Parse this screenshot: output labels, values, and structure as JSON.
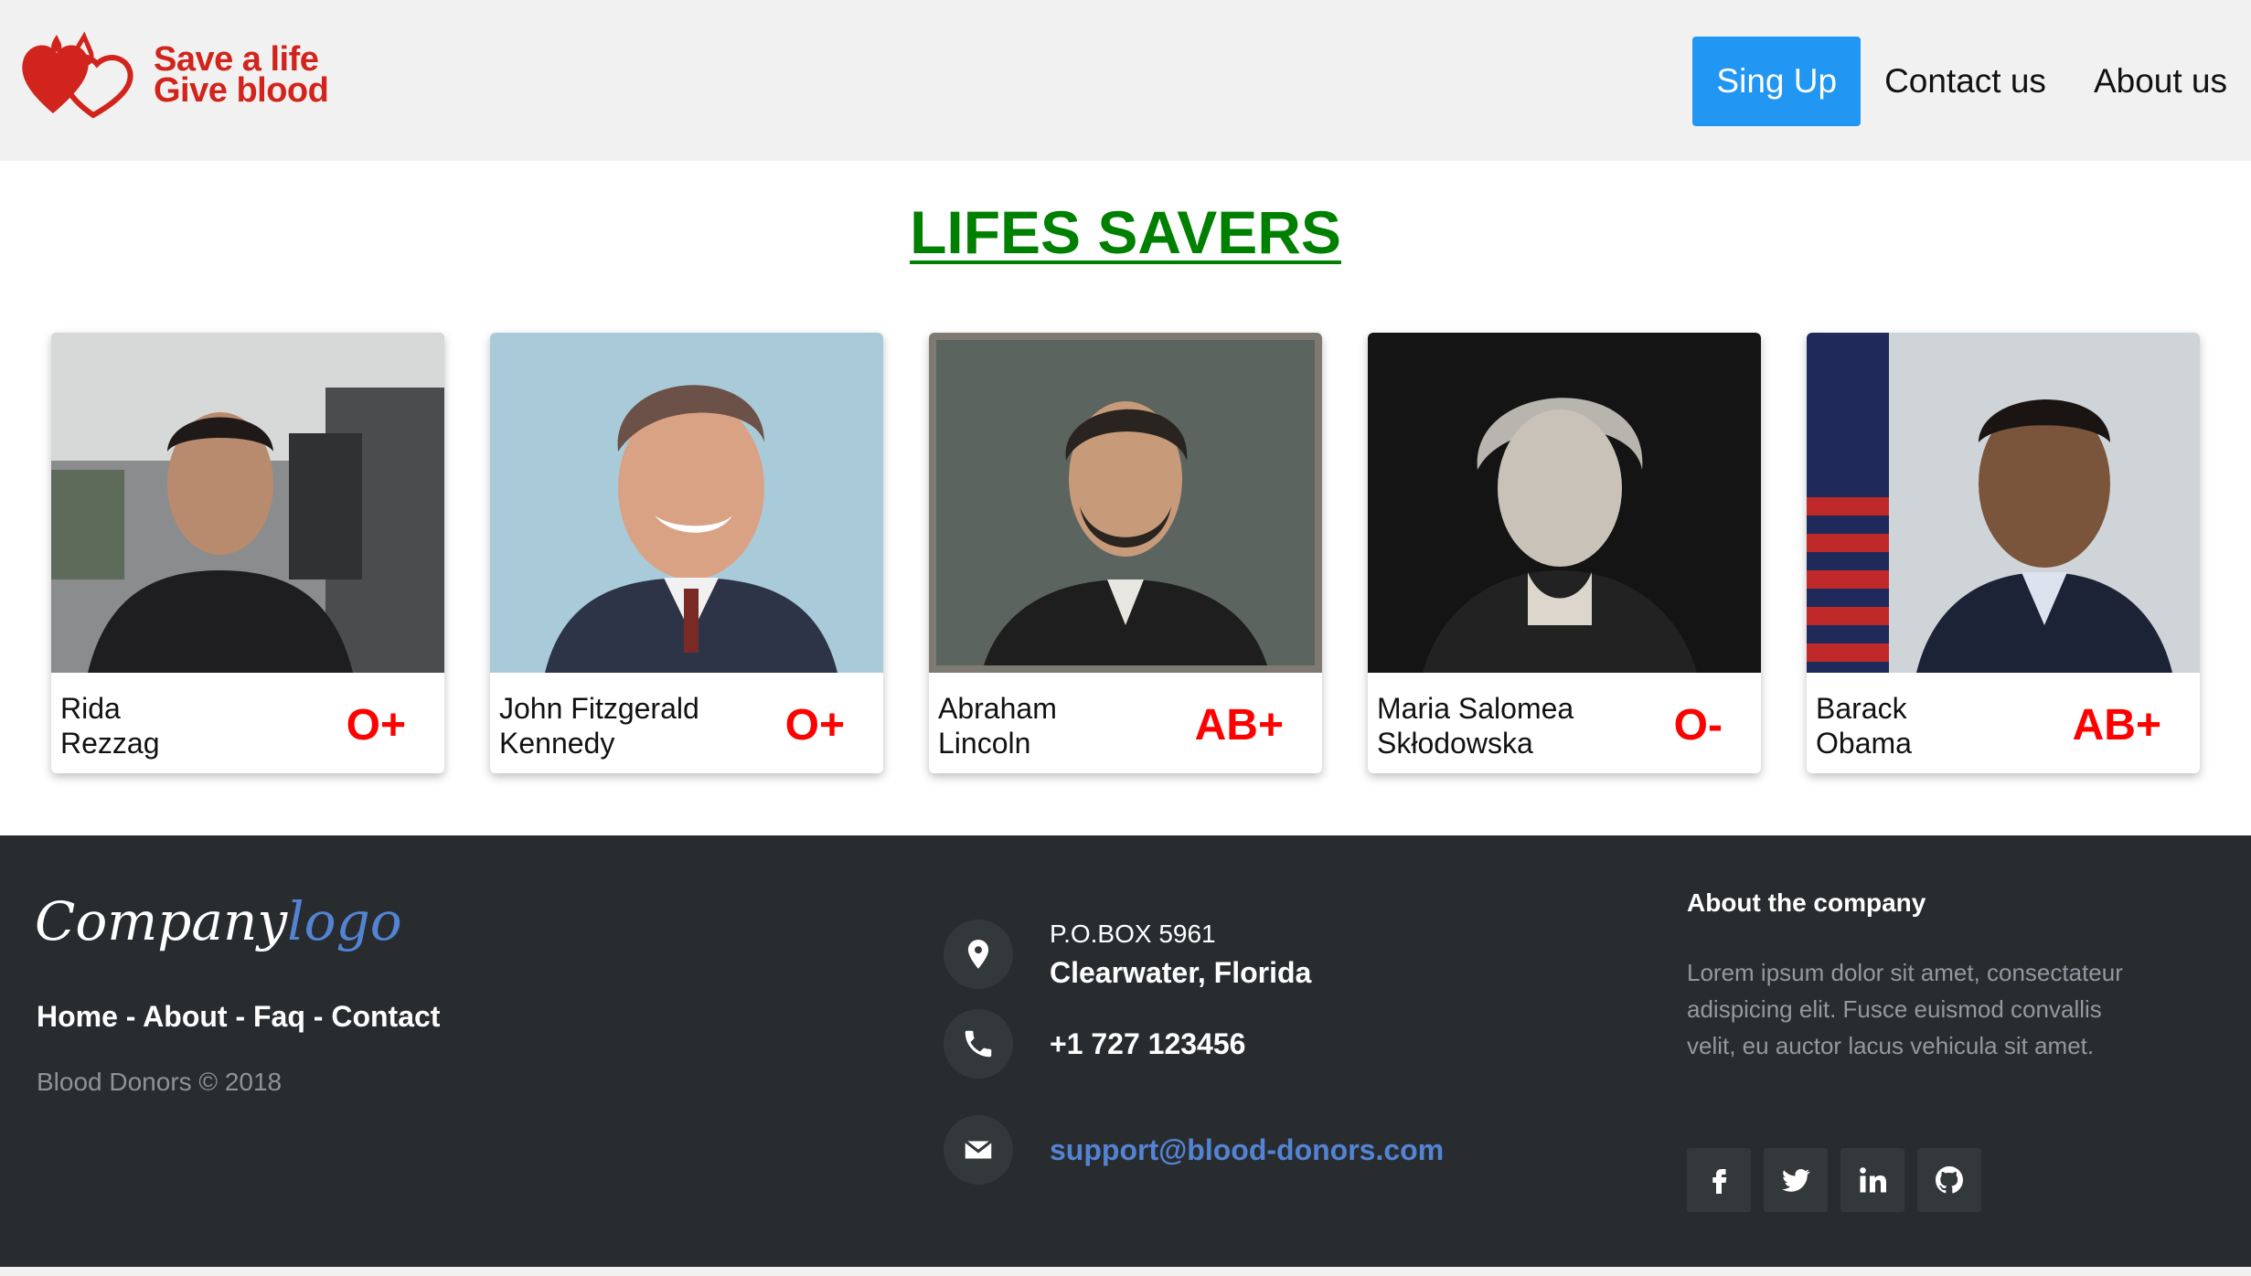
{
  "header": {
    "logo_line1": "Save a life",
    "logo_line2": "Give blood",
    "nav": {
      "signup": "Sing Up",
      "contact": "Contact us",
      "about": "About us"
    }
  },
  "main": {
    "title": "LIFES SAVERS",
    "donors": [
      {
        "first": "Rida",
        "last": "Rezzag",
        "blood": "O+"
      },
      {
        "first": "John Fitzgerald",
        "last": "Kennedy",
        "blood": "O+"
      },
      {
        "first": "Abraham",
        "last": "Lincoln",
        "blood": "AB+"
      },
      {
        "first": "Maria Salomea",
        "last": "Skłodowska",
        "blood": "O-"
      },
      {
        "first": "Barack",
        "last": "Obama",
        "blood": "AB+"
      }
    ]
  },
  "footer": {
    "brand_main": "Company",
    "brand_accent": "logo",
    "links": {
      "home": "Home",
      "about": "About",
      "faq": "Faq",
      "contact": "Contact",
      "sep": " - "
    },
    "copyright": "Blood Donors © 2018",
    "address_line1": "P.O.BOX 5961",
    "address_line2": "Clearwater, Florida",
    "phone": "+1 727 123456",
    "email": "support@blood-donors.com",
    "about_title": "About the company",
    "about_text": "Lorem ipsum dolor sit amet, consectateur adispicing elit. Fusce euismod convallis velit, eu auctor lacus vehicula sit amet."
  },
  "colors": {
    "brand_red": "#d1241c",
    "primary_blue": "#2196f3",
    "title_green": "#008000",
    "blood_red": "#ff0000",
    "footer_bg": "#292c2f",
    "link_blue": "#5383d3"
  },
  "icons": [
    "heart-logo-icon",
    "location-pin-icon",
    "phone-icon",
    "envelope-icon",
    "facebook-icon",
    "twitter-icon",
    "linkedin-icon",
    "github-icon"
  ]
}
